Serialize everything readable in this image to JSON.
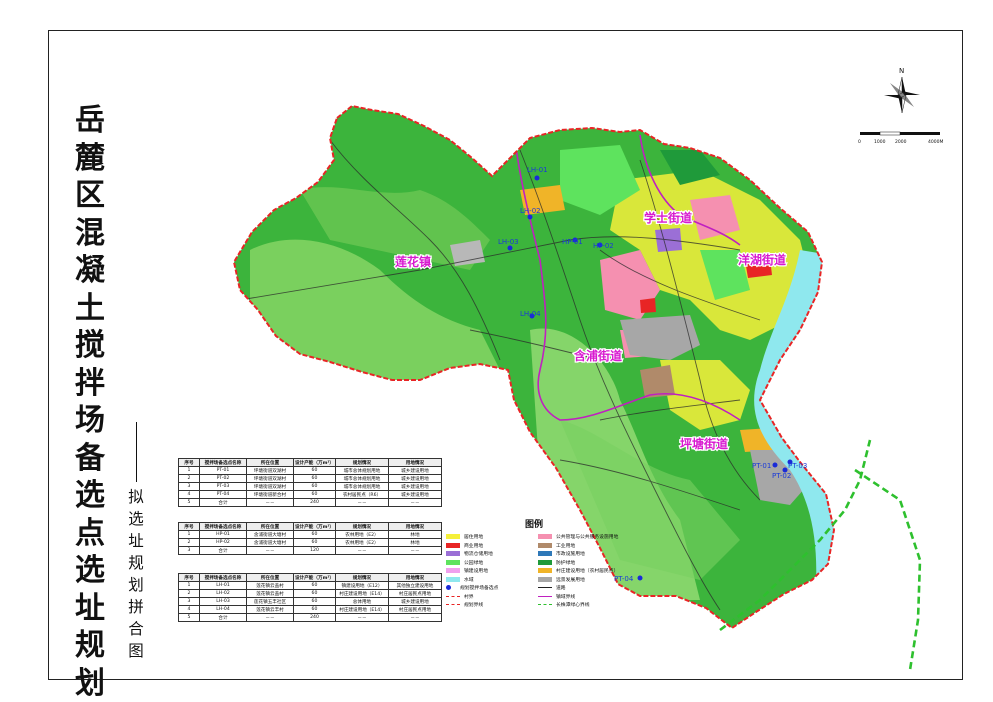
{
  "title": "岳麓区混凝土搅拌场备选点选址规划",
  "subtitle": "拟选址规划拼合图",
  "compass": {
    "label": "N"
  },
  "scale_bar": {
    "ticks": [
      "0",
      "1000",
      "2000",
      "4000M"
    ]
  },
  "districts": [
    {
      "name": "莲花镇"
    },
    {
      "name": "学士街道"
    },
    {
      "name": "洋湖街道"
    },
    {
      "name": "含浦街道"
    },
    {
      "name": "坪塘街道"
    }
  ],
  "site_labels": [
    "LH-01",
    "LH-02",
    "LH-03",
    "LH-04",
    "HP-01",
    "HP-02",
    "PT-01",
    "PT-02",
    "PT-03",
    "PT-04"
  ],
  "table_headers": [
    "序号",
    "搅拌场备选点名称",
    "所在位置",
    "设计产能（万m³）",
    "规划情况",
    "用地情况"
  ],
  "tables": [
    {
      "rows": [
        [
          "1",
          "PT-01",
          "坪塘街道双湖村",
          "60",
          "城市总体规划用地",
          "城乡建设用地"
        ],
        [
          "2",
          "PT-02",
          "坪塘街道双湖村",
          "60",
          "城市总体规划用地",
          "城乡建设用地"
        ],
        [
          "3",
          "PT-03",
          "坪塘街道双湖村",
          "60",
          "城市总体规划用地",
          "城乡建设用地"
        ],
        [
          "4",
          "PT-04",
          "坪塘街道新合村",
          "60",
          "农村居民点（R6）",
          "城乡建设用地"
        ],
        [
          "5",
          "合计",
          "－－",
          "240",
          "－－",
          "－－"
        ]
      ]
    },
    {
      "rows": [
        [
          "1",
          "HP-01",
          "含浦街道大塘村",
          "60",
          "农林用地（E2）",
          "林地"
        ],
        [
          "2",
          "HP-02",
          "含浦街道大塘村",
          "60",
          "农林用地（E2）",
          "林地"
        ],
        [
          "3",
          "合计",
          "－－",
          "120",
          "－－",
          "－－"
        ]
      ]
    },
    {
      "rows": [
        [
          "1",
          "LH-01",
          "莲花镇云盖村",
          "60",
          "镇建设用地（E12）",
          "其他独立建设用地"
        ],
        [
          "2",
          "LH-02",
          "莲花镇云盖村",
          "60",
          "村庄建设用地（E14）",
          "村庄居民点用地"
        ],
        [
          "3",
          "LH-03",
          "莲花镇五丰社区",
          "60",
          "总体用地",
          "城乡建设用地"
        ],
        [
          "4",
          "LH-04",
          "莲花镇云丰村",
          "60",
          "村庄建设用地（E14）",
          "村庄居民点用地"
        ],
        [
          "5",
          "合计",
          "－－",
          "240",
          "－－",
          "－－"
        ]
      ]
    }
  ],
  "legend": {
    "title": "图例",
    "items": [
      {
        "label": "居住用地",
        "color": "#f5f03a",
        "kind": "fill"
      },
      {
        "label": "公共管理与公共服务设施用地",
        "color": "#f590b0",
        "kind": "fill"
      },
      {
        "label": "商业用地",
        "color": "#e82525",
        "kind": "fill"
      },
      {
        "label": "工业用地",
        "color": "#b08a6a",
        "kind": "fill"
      },
      {
        "label": "物流仓储用地",
        "color": "#9b6fd6",
        "kind": "fill"
      },
      {
        "label": "市政设施用地",
        "color": "#2e78b8",
        "kind": "fill"
      },
      {
        "label": "公园绿地",
        "color": "#5ee35e",
        "kind": "fill"
      },
      {
        "label": "防护绿地",
        "color": "#1f9a3a",
        "kind": "fill"
      },
      {
        "label": "镇建设用地",
        "color": "#f0a0ee",
        "kind": "fill"
      },
      {
        "label": "村庄建设用地（农村居民点）",
        "color": "#f0b428",
        "kind": "fill"
      },
      {
        "label": "水域",
        "color": "#8fe8ee",
        "kind": "fill"
      },
      {
        "label": "远景发展用地",
        "color": "#a7a7a7",
        "kind": "fill"
      },
      {
        "label": "规划搅拌场备选点",
        "color": "#1a2ad8",
        "kind": "dot"
      },
      {
        "label": "道路",
        "color": "#222222",
        "kind": "line"
      },
      {
        "label": "村界",
        "color": "#e82525",
        "kind": "dashed"
      },
      {
        "label": "镇域界线",
        "color": "#c020c0",
        "kind": "line"
      },
      {
        "label": "规划界线",
        "color": "#e82525",
        "kind": "dashdot"
      },
      {
        "label": "长株潭绿心界线",
        "color": "#2ec02e",
        "kind": "dashed"
      }
    ]
  }
}
